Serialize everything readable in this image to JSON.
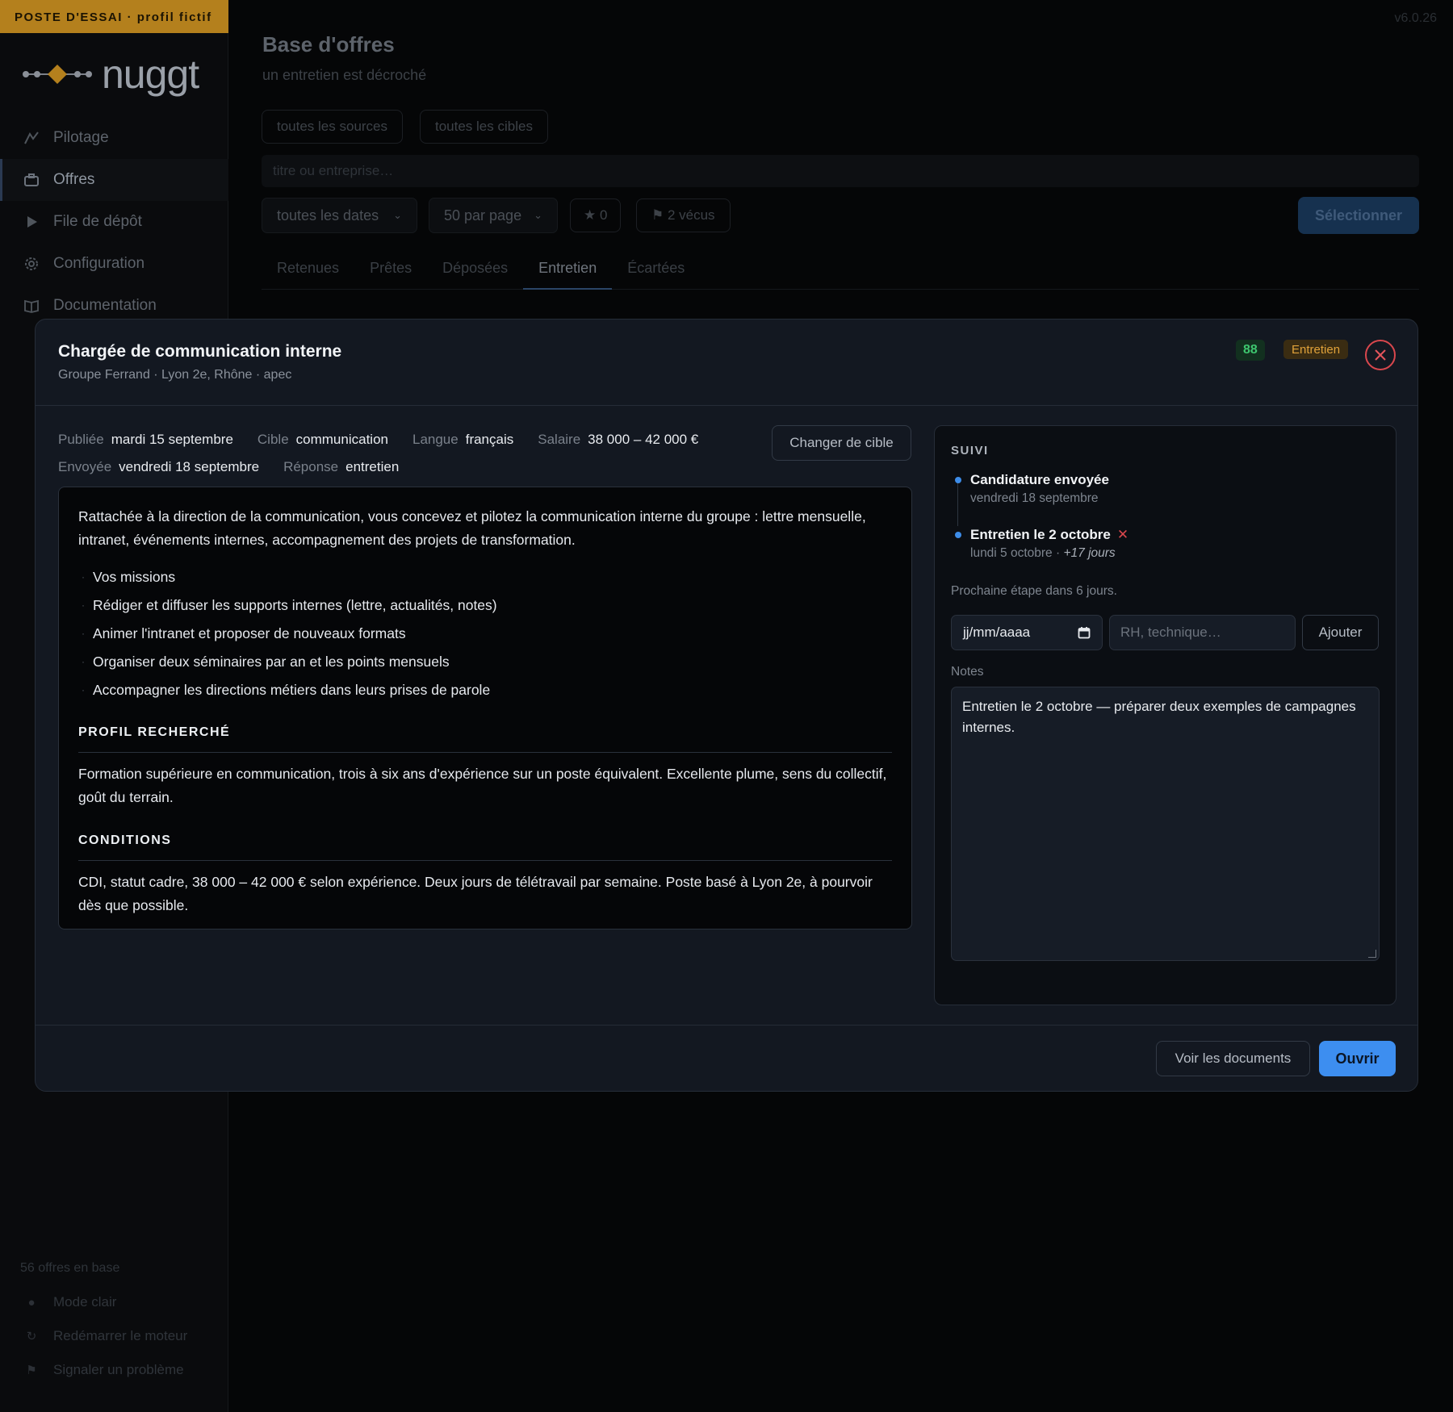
{
  "env_banner": "POSTE D'ESSAI · profil fictif",
  "brand": "nuggt",
  "version": "v6.0.26",
  "sidebar": {
    "items": [
      {
        "label": "Pilotage",
        "icon": "chart-line-icon"
      },
      {
        "label": "Offres",
        "icon": "briefcase-icon",
        "active": true
      },
      {
        "label": "File de dépôt",
        "icon": "play-icon"
      },
      {
        "label": "Configuration",
        "icon": "gear-icon"
      },
      {
        "label": "Documentation",
        "icon": "book-icon"
      }
    ],
    "count": "56 offres en base",
    "footer": [
      {
        "label": "Mode clair",
        "icon": "sun-icon"
      },
      {
        "label": "Redémarrer le moteur",
        "icon": "restart-icon"
      },
      {
        "label": "Signaler un problème",
        "icon": "flag-icon"
      }
    ]
  },
  "main": {
    "title": "Base d'offres",
    "subtitle": "un entretien est décroché",
    "filters": {
      "sources": "toutes les sources",
      "targets": "toutes les cibles",
      "search_placeholder": "titre ou entreprise…",
      "dates": "toutes les dates",
      "per_page": "50 par page",
      "stars": "★ 0",
      "seen": "⚑ 2 vécus",
      "select_button": "Sélectionner"
    },
    "tabs": [
      "Retenues",
      "Prêtes",
      "Déposées",
      "Entretien",
      "Écartées"
    ],
    "active_tab": "Entretien"
  },
  "modal": {
    "title": "Chargée de communication interne",
    "subtitle": "Groupe Ferrand · Lyon 2e, Rhône · apec",
    "score": "88",
    "stage": "Entretien",
    "meta": {
      "published_label": "Publiée",
      "published_value": "mardi 15 septembre",
      "target_label": "Cible",
      "target_value": "communication",
      "language_label": "Langue",
      "language_value": "français",
      "salary_label": "Salaire",
      "salary_value": "38 000 – 42 000 €",
      "sent_label": "Envoyée",
      "sent_value": "vendredi 18 septembre",
      "response_label": "Réponse",
      "response_value": "entretien"
    },
    "change_target_button": "Changer de cible",
    "description": {
      "intro": "Rattachée à la direction de la communication, vous concevez et pilotez la communication interne du groupe : lettre mensuelle, intranet, événements internes, accompagnement des projets de transformation.",
      "bullets": [
        "Vos missions",
        "Rédiger et diffuser les supports internes (lettre, actualités, notes)",
        "Animer l'intranet et proposer de nouveaux formats",
        "Organiser deux séminaires par an et les points mensuels",
        "Accompagner les directions métiers dans leurs prises de parole"
      ],
      "profile_heading": "PROFIL RECHERCHÉ",
      "profile_text": "Formation supérieure en communication, trois à six ans d'expérience sur un poste équivalent. Excellente plume, sens du collectif, goût du terrain.",
      "conditions_heading": "CONDITIONS",
      "conditions_text": "CDI, statut cadre, 38 000 – 42 000 € selon expérience. Deux jours de télétravail par semaine. Poste basé à Lyon 2e, à pourvoir dès que possible."
    },
    "suivi": {
      "title": "SUIVI",
      "events": [
        {
          "title": "Candidature envoyée",
          "sub": "vendredi 18 septembre",
          "extra": ""
        },
        {
          "title": "Entretien le 2 octobre",
          "sub": "lundi 5 octobre · ",
          "extra": "+17 jours"
        }
      ],
      "next_step": "Prochaine étape dans 6 jours.",
      "date_placeholder": "jj/mm/aaaa",
      "type_placeholder": "RH, technique…",
      "add_button": "Ajouter",
      "notes_label": "Notes",
      "notes_text": "Entretien le 2 octobre — préparer deux exemples de campagnes internes."
    },
    "docs_button": "Voir les documents",
    "open_button": "Ouvrir"
  }
}
